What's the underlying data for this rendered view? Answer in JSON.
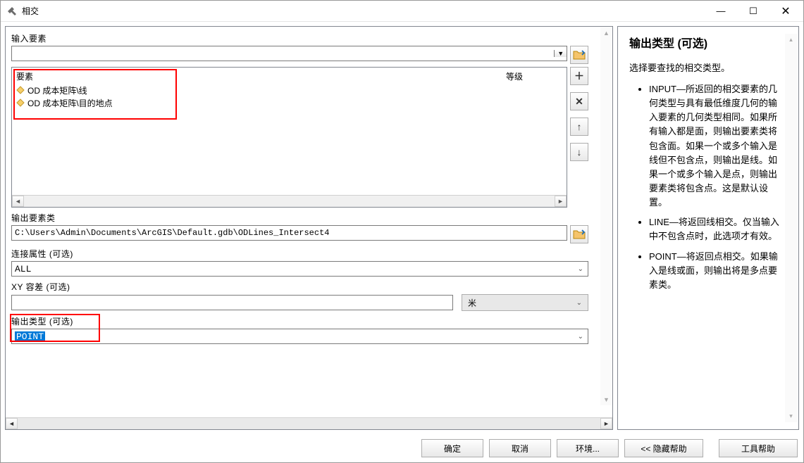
{
  "window": {
    "title": "相交"
  },
  "titlebar_buttons": {
    "minimize": "—",
    "maximize": "☐",
    "close": "✕"
  },
  "form": {
    "input_features_label": "输入要素",
    "feature_table": {
      "col1": "要素",
      "col2": "等级",
      "items": [
        "OD 成本矩阵\\线",
        "OD 成本矩阵\\目的地点"
      ]
    },
    "output_fc_label": "输出要素类",
    "output_fc_value": "C:\\Users\\Admin\\Documents\\ArcGIS\\Default.gdb\\ODLines_Intersect4",
    "join_attr_label": "连接属性 (可选)",
    "join_attr_value": "ALL",
    "xy_tol_label": "XY 容差 (可选)",
    "xy_tol_value": "",
    "xy_tol_unit": "米",
    "output_type_label": "输出类型 (可选)",
    "output_type_value": "POINT"
  },
  "tools": {
    "add": "＋",
    "remove": "✕",
    "up": "↑",
    "down": "↓"
  },
  "help": {
    "title": "输出类型 (可选)",
    "desc": "选择要查找的相交类型。",
    "items": [
      "INPUT—所返回的相交要素的几何类型与具有最低维度几何的输入要素的几何类型相同。如果所有输入都是面，则输出要素类将包含面。如果一个或多个输入是线但不包含点，则输出是线。如果一个或多个输入是点，则输出要素类将包含点。这是默认设置。",
      "LINE—将返回线相交。仅当输入中不包含点时，此选项才有效。",
      "POINT—将返回点相交。如果输入是线或面，则输出将是多点要素类。"
    ]
  },
  "buttons": {
    "ok": "确定",
    "cancel": "取消",
    "env": "环境...",
    "hide_help": "<< 隐藏帮助",
    "tool_help": "工具帮助"
  }
}
